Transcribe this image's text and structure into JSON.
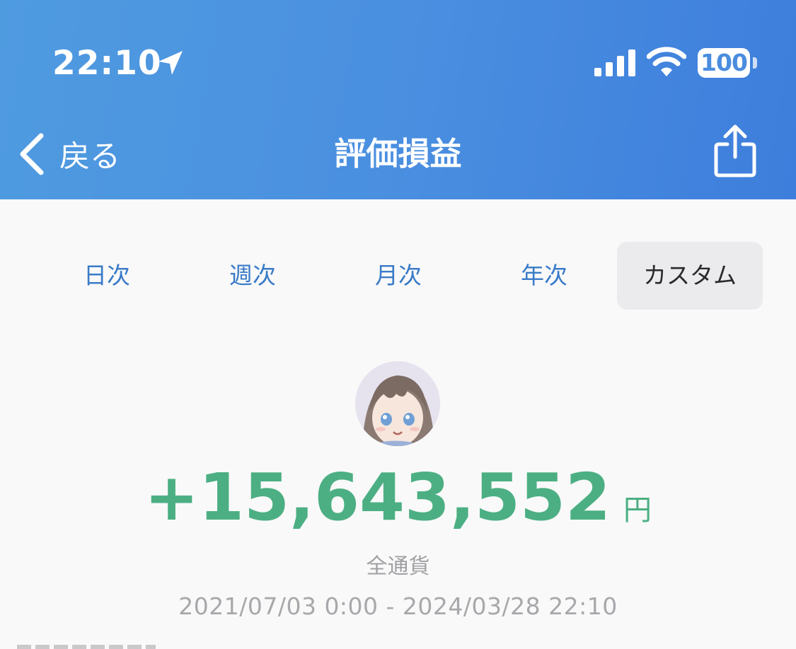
{
  "status_bar": {
    "time": "22:10",
    "battery": "100",
    "icons": [
      "location-arrow-icon",
      "cellular-signal-icon",
      "wifi-icon",
      "battery-icon"
    ]
  },
  "nav": {
    "back_label": "戻る",
    "title": "評価損益",
    "share_icon": "share-icon"
  },
  "tabs": [
    {
      "label": "日次",
      "active": false
    },
    {
      "label": "週次",
      "active": false
    },
    {
      "label": "月次",
      "active": false
    },
    {
      "label": "年次",
      "active": false
    },
    {
      "label": "カスタム",
      "active": true
    }
  ],
  "summary": {
    "amount": "+15,643,552",
    "currency": "円",
    "scope": "全通貨",
    "range": "2021/07/03 0:00 - 2024/03/28 22:10"
  },
  "colors": {
    "header_gradient_start": "#4f9be0",
    "header_gradient_end": "#3d7edc",
    "accent_blue": "#3a7bc8",
    "profit_green": "#4caf83",
    "background": "#f9f9f9",
    "active_segment": "#ebebed"
  }
}
